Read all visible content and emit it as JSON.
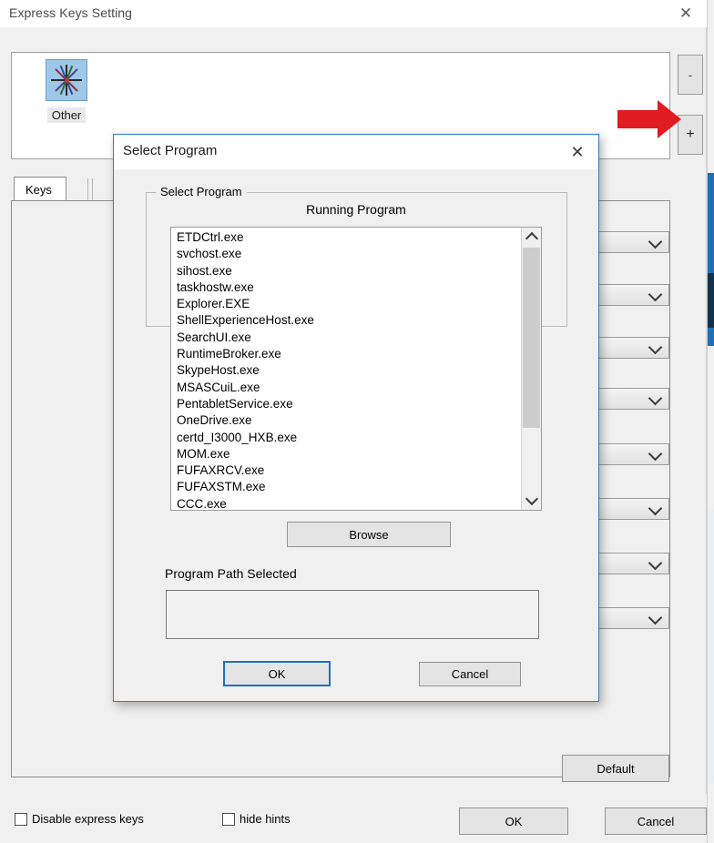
{
  "window": {
    "title": "Express Keys Setting",
    "close_icon": "close-icon"
  },
  "program_panel": {
    "items": [
      {
        "label": "Other",
        "icon": "starburst-icon"
      }
    ],
    "remove_button": "-",
    "add_button": "+"
  },
  "annotation": {
    "arrow": "red-arrow-pointing-to-add-button",
    "color": "#e01b24"
  },
  "tabs": [
    {
      "label": "Keys",
      "selected": true
    }
  ],
  "key_rows": [
    {
      "combo_value": ""
    },
    {
      "combo_value": ""
    },
    {
      "combo_value": ""
    },
    {
      "combo_value": ""
    },
    {
      "combo_value": ""
    },
    {
      "combo_value": ""
    },
    {
      "combo_value": ""
    },
    {
      "combo_value": ""
    }
  ],
  "default_button": {
    "label": "Default"
  },
  "bottom_bar": {
    "disable_checkbox": {
      "label": "Disable express keys",
      "checked": false
    },
    "hints_checkbox": {
      "label": "hide hints",
      "checked": false
    },
    "ok_label": "OK",
    "cancel_label": "Cancel"
  },
  "dialog": {
    "title": "Select Program",
    "close_icon": "close-icon",
    "groupbox_caption": "Select Program",
    "running_program_label": "Running Program",
    "program_list": [
      "ETDCtrl.exe",
      "svchost.exe",
      "sihost.exe",
      "taskhostw.exe",
      "Explorer.EXE",
      "ShellExperienceHost.exe",
      "SearchUI.exe",
      "RuntimeBroker.exe",
      "SkypeHost.exe",
      "MSASCuiL.exe",
      "PentabletService.exe",
      "OneDrive.exe",
      "certd_I3000_HXB.exe",
      "MOM.exe",
      "FUFAXRCV.exe",
      "FUFAXSTM.exe",
      "CCC.exe"
    ],
    "browse_label": "Browse",
    "path_label": "Program Path Selected",
    "path_value": "",
    "ok_label": "OK",
    "cancel_label": "Cancel",
    "accent_color": "#2e7dd1"
  }
}
